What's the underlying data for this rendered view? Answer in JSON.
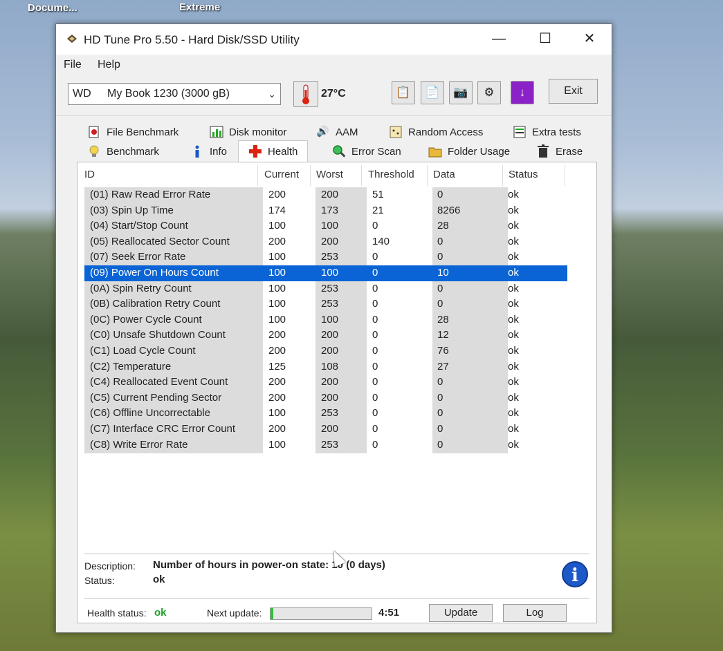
{
  "desktop": {
    "icon1_label": "Docume...",
    "icon2_label": "Extreme"
  },
  "window": {
    "title": "HD Tune Pro 5.50 - Hard Disk/SSD Utility"
  },
  "menu": [
    "File",
    "Help"
  ],
  "toolbar": {
    "drive_vendor": "WD",
    "drive_model": "My Book 1230 (3000 gB)",
    "temperature": "27°C",
    "exit_label": "Exit"
  },
  "tabs_row1": [
    "File Benchmark",
    "Disk monitor",
    "AAM",
    "Random Access",
    "Extra tests"
  ],
  "tabs_row2": [
    "Benchmark",
    "Info",
    "Health",
    "Error Scan",
    "Folder Usage",
    "Erase"
  ],
  "active_tab": "Health",
  "table": {
    "columns": [
      "ID",
      "Current",
      "Worst",
      "Threshold",
      "Data",
      "Status"
    ],
    "rows": [
      {
        "id": "(01) Raw Read Error Rate",
        "current": "200",
        "worst": "200",
        "threshold": "51",
        "data": "0",
        "status": "ok"
      },
      {
        "id": "(03) Spin Up Time",
        "current": "174",
        "worst": "173",
        "threshold": "21",
        "data": "8266",
        "status": "ok"
      },
      {
        "id": "(04) Start/Stop Count",
        "current": "100",
        "worst": "100",
        "threshold": "0",
        "data": "28",
        "status": "ok"
      },
      {
        "id": "(05) Reallocated Sector Count",
        "current": "200",
        "worst": "200",
        "threshold": "140",
        "data": "0",
        "status": "ok"
      },
      {
        "id": "(07) Seek Error Rate",
        "current": "100",
        "worst": "253",
        "threshold": "0",
        "data": "0",
        "status": "ok"
      },
      {
        "id": "(09) Power On Hours Count",
        "current": "100",
        "worst": "100",
        "threshold": "0",
        "data": "10",
        "status": "ok"
      },
      {
        "id": "(0A) Spin Retry Count",
        "current": "100",
        "worst": "253",
        "threshold": "0",
        "data": "0",
        "status": "ok"
      },
      {
        "id": "(0B) Calibration Retry Count",
        "current": "100",
        "worst": "253",
        "threshold": "0",
        "data": "0",
        "status": "ok"
      },
      {
        "id": "(0C) Power Cycle Count",
        "current": "100",
        "worst": "100",
        "threshold": "0",
        "data": "28",
        "status": "ok"
      },
      {
        "id": "(C0) Unsafe Shutdown Count",
        "current": "200",
        "worst": "200",
        "threshold": "0",
        "data": "12",
        "status": "ok"
      },
      {
        "id": "(C1) Load Cycle Count",
        "current": "200",
        "worst": "200",
        "threshold": "0",
        "data": "76",
        "status": "ok"
      },
      {
        "id": "(C2) Temperature",
        "current": "125",
        "worst": "108",
        "threshold": "0",
        "data": "27",
        "status": "ok"
      },
      {
        "id": "(C4) Reallocated Event Count",
        "current": "200",
        "worst": "200",
        "threshold": "0",
        "data": "0",
        "status": "ok"
      },
      {
        "id": "(C5) Current Pending Sector",
        "current": "200",
        "worst": "200",
        "threshold": "0",
        "data": "0",
        "status": "ok"
      },
      {
        "id": "(C6) Offline Uncorrectable",
        "current": "100",
        "worst": "253",
        "threshold": "0",
        "data": "0",
        "status": "ok"
      },
      {
        "id": "(C7) Interface CRC Error Count",
        "current": "200",
        "worst": "200",
        "threshold": "0",
        "data": "0",
        "status": "ok"
      },
      {
        "id": "(C8) Write Error Rate",
        "current": "100",
        "worst": "253",
        "threshold": "0",
        "data": "0",
        "status": "ok"
      }
    ],
    "selected_index": 5
  },
  "details": {
    "description_label": "Description:",
    "description_value": "Number of hours in power-on state: 10 (0 days)",
    "status_label": "Status:",
    "status_value": "ok"
  },
  "footer": {
    "health_label": "Health status:",
    "health_value": "ok",
    "next_update_label": "Next update:",
    "progress_fraction": 0.03,
    "countdown": "4:51",
    "update_label": "Update",
    "log_label": "Log"
  },
  "colors": {
    "selection": "#0a64d6",
    "ok_green": "#1aa02a",
    "info_blue": "#1d58c9",
    "erase_purple": "#8a22c8"
  }
}
